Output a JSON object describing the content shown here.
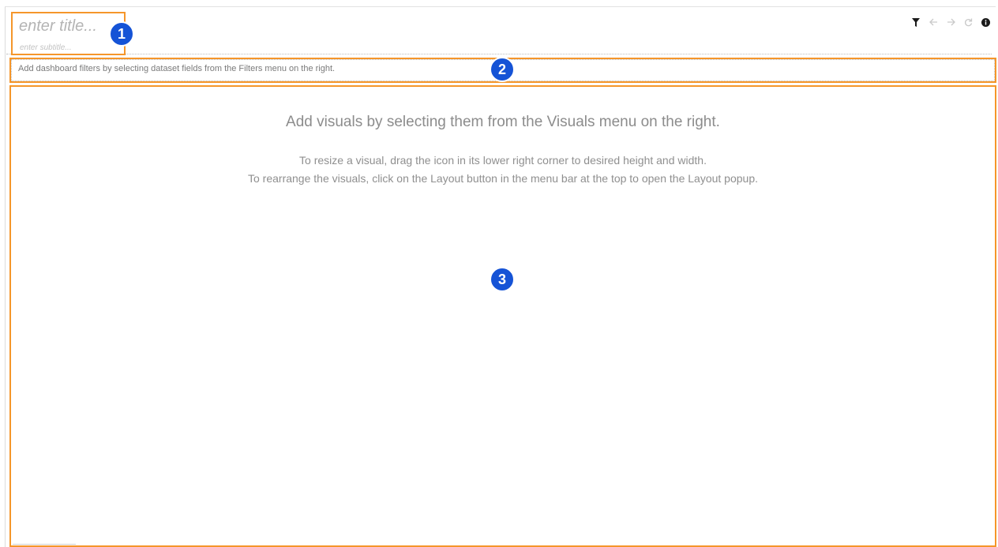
{
  "header": {
    "title_placeholder": "enter title...",
    "subtitle_placeholder": "enter subtitle..."
  },
  "toolbar": {
    "icons": [
      "filter-icon",
      "undo-arrow-icon",
      "redo-arrow-icon",
      "refresh-icon",
      "info-icon"
    ]
  },
  "filters": {
    "hint": "Add dashboard filters by selecting dataset fields from the Filters menu on the right."
  },
  "main": {
    "heading": "Add visuals by selecting them from the Visuals menu on the right.",
    "line1": "To resize a visual, drag the icon in its lower right corner to desired height and width.",
    "line2": "To rearrange the visuals, click on the Layout button in the menu bar at the top to open the Layout popup."
  },
  "callouts": {
    "one": "1",
    "two": "2",
    "three": "3"
  },
  "colors": {
    "highlight": "#f5962a",
    "badge": "#1553d6"
  }
}
